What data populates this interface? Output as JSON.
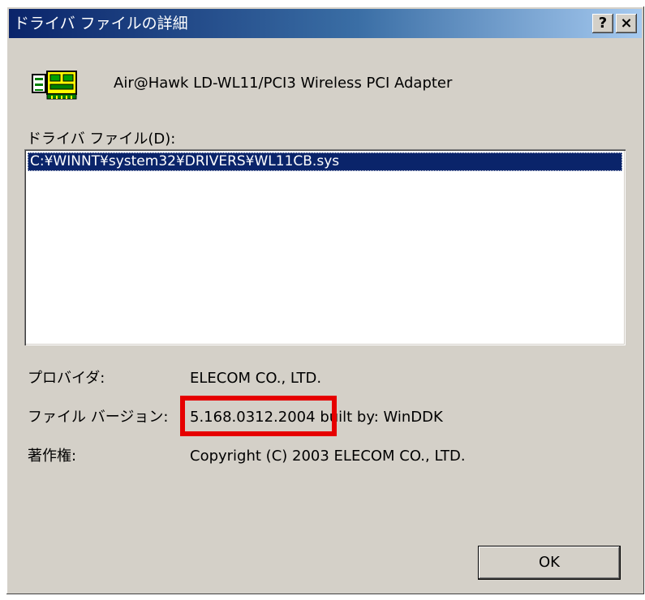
{
  "window": {
    "title": "ドライバ ファイルの詳細",
    "help_label": "?",
    "close_label": "×"
  },
  "device": {
    "icon": "network-card-icon",
    "name": "Air@Hawk LD-WL11/PCI3 Wireless PCI Adapter"
  },
  "driver_files": {
    "label": "ドライバ ファイル(D):",
    "items": [
      "C:¥WINNT¥system32¥DRIVERS¥WL11CB.sys"
    ]
  },
  "details": {
    "provider_label": "プロバイダ:",
    "provider_value": "ELECOM CO., LTD.",
    "version_label": "ファイル バージョン:",
    "version_value": "5.168.0312.2004 built by: WinDDK",
    "copyright_label": "著作権:",
    "copyright_value": "Copyright (C) 2003 ELECOM CO., LTD."
  },
  "buttons": {
    "ok_label": "OK"
  },
  "colors": {
    "dialog_bg": "#d4d0c8",
    "title_start": "#0a246a",
    "title_end": "#a6caf0",
    "selection": "#0a246a",
    "highlight_border": "#e60000"
  }
}
